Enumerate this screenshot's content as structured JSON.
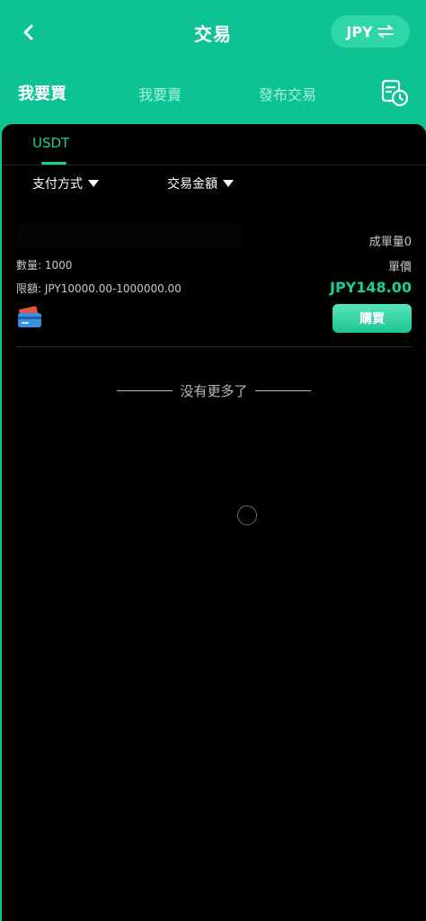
{
  "header": {
    "title": "交易",
    "currency_label": "JPY",
    "tabs": [
      {
        "label": "我要買",
        "active": true
      },
      {
        "label": "我要賣",
        "active": false
      },
      {
        "label": "發布交易",
        "active": false
      }
    ]
  },
  "coin_tabs": [
    {
      "label": "USDT",
      "active": true
    }
  ],
  "filters": {
    "payment_method": "支付方式",
    "trade_amount": "交易金額"
  },
  "listing": {
    "deal_count": "成單量0",
    "quantity": "數量: 1000",
    "unit_price_label": "單價",
    "limit": "限額: JPY10000.00-1000000.00",
    "price": "JPY148.00",
    "buy_label": "購買"
  },
  "footer_note": "没有更多了",
  "colors": {
    "brand": "#0ec393",
    "accent_text": "#19d09d",
    "background": "#000000"
  },
  "icons": [
    "back-icon",
    "swap-icon",
    "history-clock-icon",
    "card-payment-icon",
    "loading-spinner-icon"
  ]
}
